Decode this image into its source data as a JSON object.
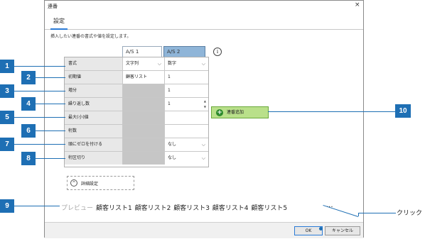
{
  "dialog": {
    "title": "連番",
    "close_glyph": "×",
    "tab": "設定",
    "description": "挿入したい連番の書式や値を設定します。",
    "info_glyph": "i",
    "columns": [
      "A/S 1",
      "A/S 2"
    ],
    "rows": [
      {
        "label": "書式",
        "col1": "文字列",
        "col2": "数字"
      },
      {
        "label": "初期値",
        "col1": "顧客リスト",
        "col2": "1"
      },
      {
        "label": "増分",
        "col1": "",
        "col2": "1"
      },
      {
        "label": "繰り返し数",
        "col1": "",
        "col2": "1"
      },
      {
        "label": "最大(小)値",
        "col1": "",
        "col2": ""
      },
      {
        "label": "桁数",
        "col1": "",
        "col2": ""
      },
      {
        "label": "頭にゼロを付ける",
        "col1": "",
        "col2": "なし"
      },
      {
        "label": "桁区切り",
        "col1": "",
        "col2": "なし"
      }
    ],
    "add_button": "連番追加",
    "detail_button": "詳細設定",
    "preview_label": "プレビュー",
    "preview_text": "顧客リスト1 顧客リスト2 顧客リスト3 顧客リスト4 顧客リスト5",
    "ellipsis": "...",
    "ok_button": "OK",
    "cancel_button": "キャンセル"
  },
  "annotations": {
    "badges": [
      "1",
      "2",
      "3",
      "4",
      "5",
      "6",
      "7",
      "8",
      "9",
      "10"
    ],
    "click_label": "クリック"
  },
  "icons": {
    "add": "plus-circle-icon",
    "detail": "chevron-up-circle-icon",
    "info": "info-icon"
  },
  "colors": {
    "accent": "#1e6fb4",
    "add_button_bg": "#b9e08a",
    "active_column": "#8fb5d8"
  }
}
